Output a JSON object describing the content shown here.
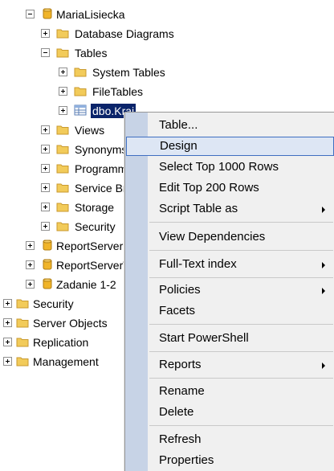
{
  "tree": {
    "items": [
      {
        "label": "MariaLisiecka",
        "icon": "database-icon",
        "expander": "minus"
      },
      {
        "label": "Database Diagrams",
        "icon": "folder-icon",
        "expander": "plus"
      },
      {
        "label": "Tables",
        "icon": "folder-icon",
        "expander": "minus"
      },
      {
        "label": "System Tables",
        "icon": "folder-icon",
        "expander": "plus"
      },
      {
        "label": "FileTables",
        "icon": "folder-icon",
        "expander": "plus"
      },
      {
        "label": "dbo.Kraj",
        "icon": "table-icon",
        "expander": "plus",
        "selected": true
      },
      {
        "label": "Views",
        "icon": "folder-icon",
        "expander": "plus"
      },
      {
        "label": "Synonyms",
        "icon": "folder-icon",
        "expander": "plus"
      },
      {
        "label": "Programmability",
        "icon": "folder-icon",
        "expander": "plus"
      },
      {
        "label": "Service Broker",
        "icon": "folder-icon",
        "expander": "plus"
      },
      {
        "label": "Storage",
        "icon": "folder-icon",
        "expander": "plus"
      },
      {
        "label": "Security",
        "icon": "folder-icon",
        "expander": "plus"
      },
      {
        "label": "ReportServer",
        "icon": "database-icon",
        "expander": "plus"
      },
      {
        "label": "ReportServerTempDB",
        "icon": "database-icon",
        "expander": "plus"
      },
      {
        "label": "Zadanie 1-2",
        "icon": "database-icon",
        "expander": "plus"
      },
      {
        "label": "Security",
        "icon": "folder-icon",
        "expander": "plus"
      },
      {
        "label": "Server Objects",
        "icon": "folder-icon",
        "expander": "plus"
      },
      {
        "label": "Replication",
        "icon": "folder-icon",
        "expander": "plus"
      },
      {
        "label": "Management",
        "icon": "folder-icon",
        "expander": "plus"
      }
    ]
  },
  "context_menu": {
    "items": [
      {
        "label": "Table...",
        "submenu": false
      },
      {
        "label": "Design",
        "submenu": false,
        "highlighted": true
      },
      {
        "label": "Select Top 1000 Rows",
        "submenu": false
      },
      {
        "label": "Edit Top 200 Rows",
        "submenu": false
      },
      {
        "label": "Script Table as",
        "submenu": true
      },
      {
        "label": "View Dependencies",
        "submenu": false
      },
      {
        "label": "Full-Text index",
        "submenu": true
      },
      {
        "label": "Policies",
        "submenu": true
      },
      {
        "label": "Facets",
        "submenu": false
      },
      {
        "label": "Start PowerShell",
        "submenu": false
      },
      {
        "label": "Reports",
        "submenu": true
      },
      {
        "label": "Rename",
        "submenu": false
      },
      {
        "label": "Delete",
        "submenu": false
      },
      {
        "label": "Refresh",
        "submenu": false
      },
      {
        "label": "Properties",
        "submenu": false
      }
    ]
  },
  "colors": {
    "selection": "#0a246a",
    "menu_background": "#f0f0f0",
    "menu_gutter": "#c7d3e6",
    "menu_highlight": "#dde6f4",
    "folder": "#f2cb5a",
    "database": "#f0b429"
  }
}
